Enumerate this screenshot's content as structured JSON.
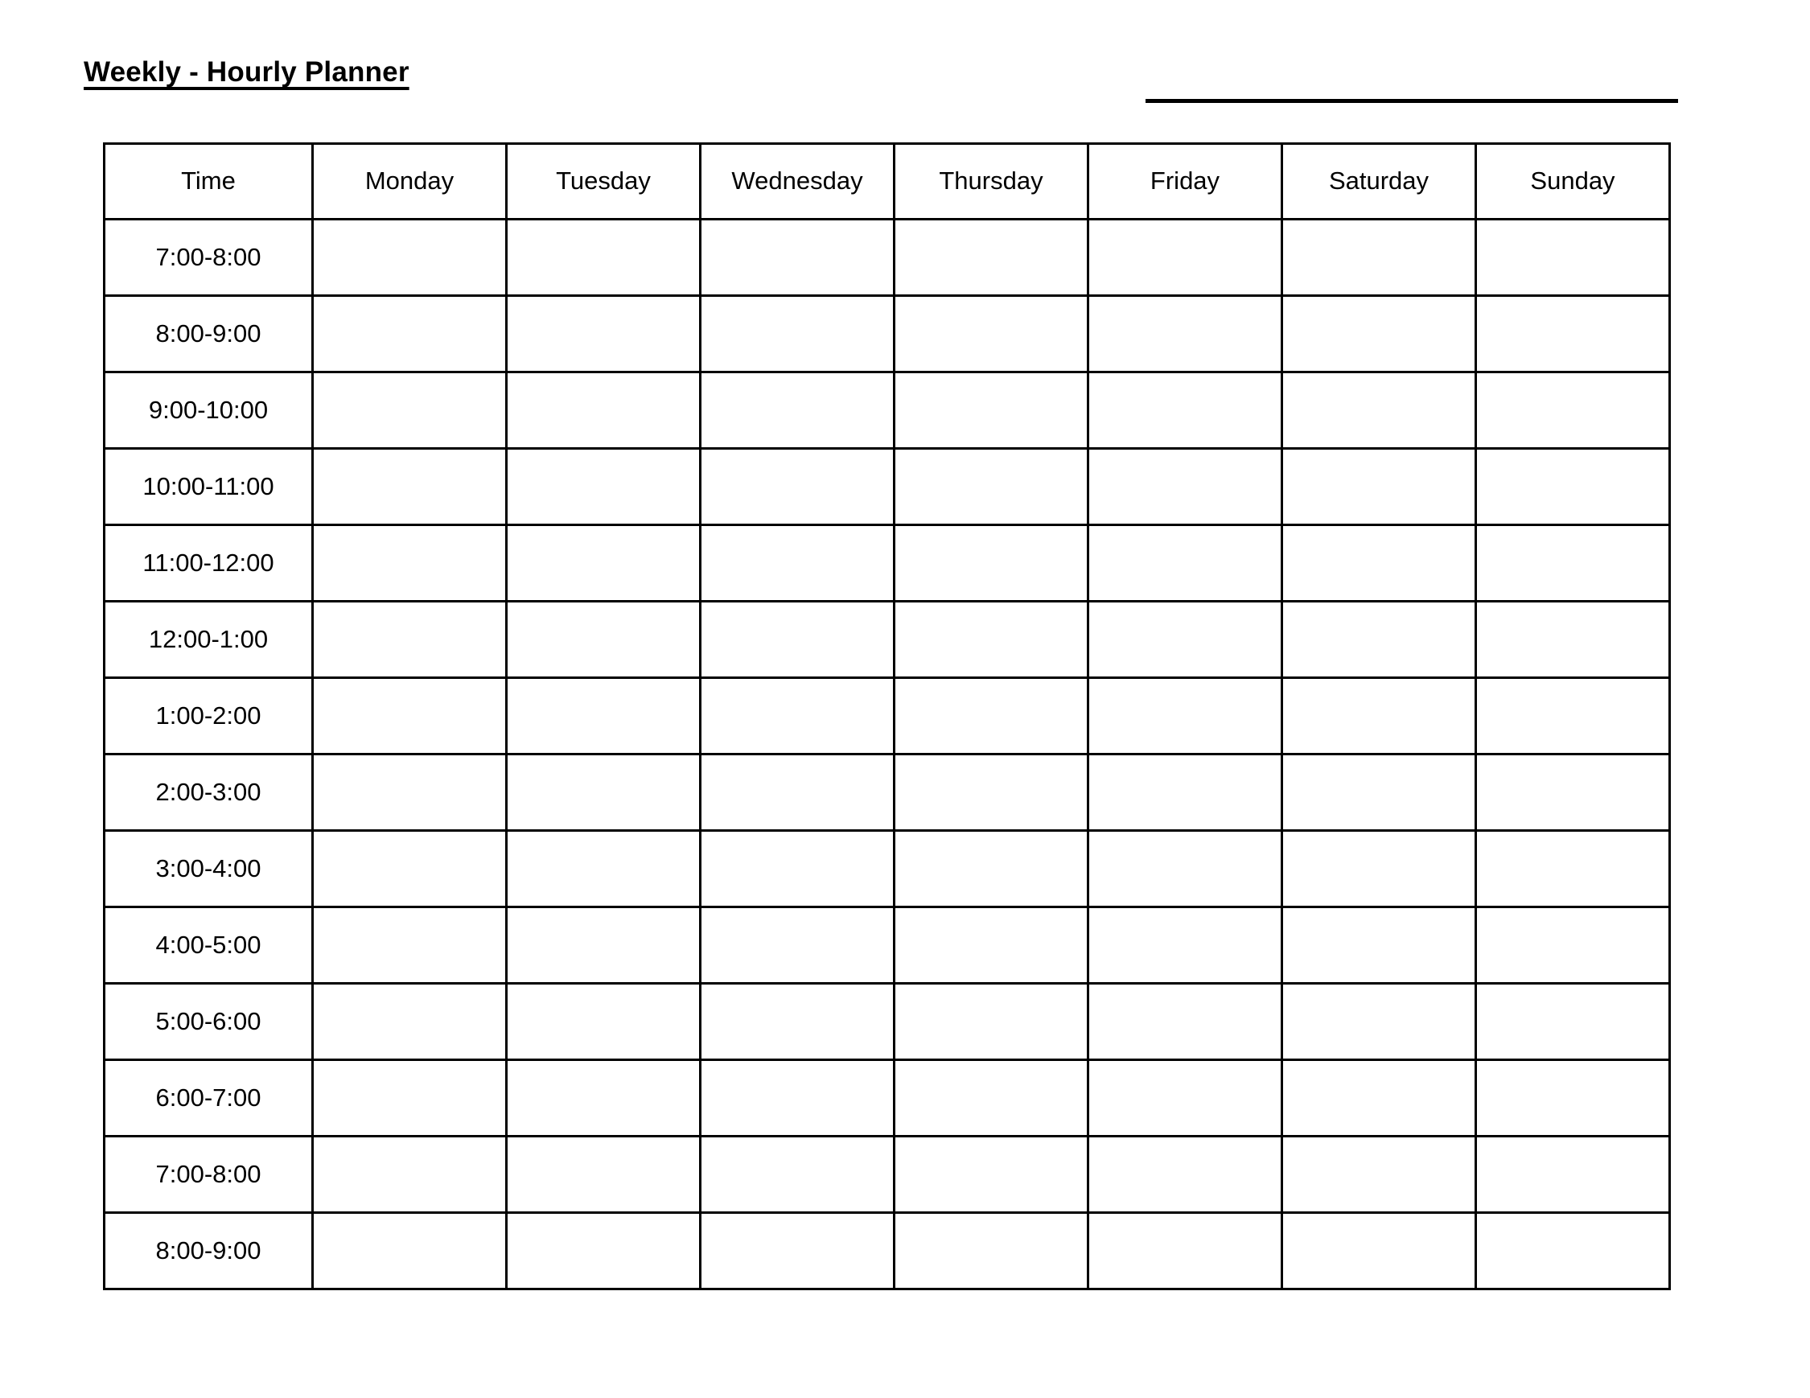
{
  "document": {
    "title": "Weekly - Hourly Planner",
    "name_line_value": ""
  },
  "table": {
    "columns": [
      {
        "key": "time",
        "label": "Time"
      },
      {
        "key": "monday",
        "label": "Monday"
      },
      {
        "key": "tuesday",
        "label": "Tuesday"
      },
      {
        "key": "wednesday",
        "label": "Wednesday"
      },
      {
        "key": "thursday",
        "label": "Thursday"
      },
      {
        "key": "friday",
        "label": "Friday"
      },
      {
        "key": "saturday",
        "label": "Saturday"
      },
      {
        "key": "sunday",
        "label": "Sunday"
      }
    ],
    "rows": [
      {
        "time": "7:00-8:00",
        "monday": "",
        "tuesday": "",
        "wednesday": "",
        "thursday": "",
        "friday": "",
        "saturday": "",
        "sunday": ""
      },
      {
        "time": "8:00-9:00",
        "monday": "",
        "tuesday": "",
        "wednesday": "",
        "thursday": "",
        "friday": "",
        "saturday": "",
        "sunday": ""
      },
      {
        "time": "9:00-10:00",
        "monday": "",
        "tuesday": "",
        "wednesday": "",
        "thursday": "",
        "friday": "",
        "saturday": "",
        "sunday": ""
      },
      {
        "time": "10:00-11:00",
        "monday": "",
        "tuesday": "",
        "wednesday": "",
        "thursday": "",
        "friday": "",
        "saturday": "",
        "sunday": ""
      },
      {
        "time": "11:00-12:00",
        "monday": "",
        "tuesday": "",
        "wednesday": "",
        "thursday": "",
        "friday": "",
        "saturday": "",
        "sunday": ""
      },
      {
        "time": "12:00-1:00",
        "monday": "",
        "tuesday": "",
        "wednesday": "",
        "thursday": "",
        "friday": "",
        "saturday": "",
        "sunday": ""
      },
      {
        "time": "1:00-2:00",
        "monday": "",
        "tuesday": "",
        "wednesday": "",
        "thursday": "",
        "friday": "",
        "saturday": "",
        "sunday": ""
      },
      {
        "time": "2:00-3:00",
        "monday": "",
        "tuesday": "",
        "wednesday": "",
        "thursday": "",
        "friday": "",
        "saturday": "",
        "sunday": ""
      },
      {
        "time": "3:00-4:00",
        "monday": "",
        "tuesday": "",
        "wednesday": "",
        "thursday": "",
        "friday": "",
        "saturday": "",
        "sunday": ""
      },
      {
        "time": "4:00-5:00",
        "monday": "",
        "tuesday": "",
        "wednesday": "",
        "thursday": "",
        "friday": "",
        "saturday": "",
        "sunday": ""
      },
      {
        "time": "5:00-6:00",
        "monday": "",
        "tuesday": "",
        "wednesday": "",
        "thursday": "",
        "friday": "",
        "saturday": "",
        "sunday": ""
      },
      {
        "time": "6:00-7:00",
        "monday": "",
        "tuesday": "",
        "wednesday": "",
        "thursday": "",
        "friday": "",
        "saturday": "",
        "sunday": ""
      },
      {
        "time": "7:00-8:00",
        "monday": "",
        "tuesday": "",
        "wednesday": "",
        "thursday": "",
        "friday": "",
        "saturday": "",
        "sunday": ""
      },
      {
        "time": "8:00-9:00",
        "monday": "",
        "tuesday": "",
        "wednesday": "",
        "thursday": "",
        "friday": "",
        "saturday": "",
        "sunday": ""
      }
    ]
  },
  "colors": {
    "ink": "#000000",
    "paper": "#ffffff",
    "grid": "#000000"
  }
}
